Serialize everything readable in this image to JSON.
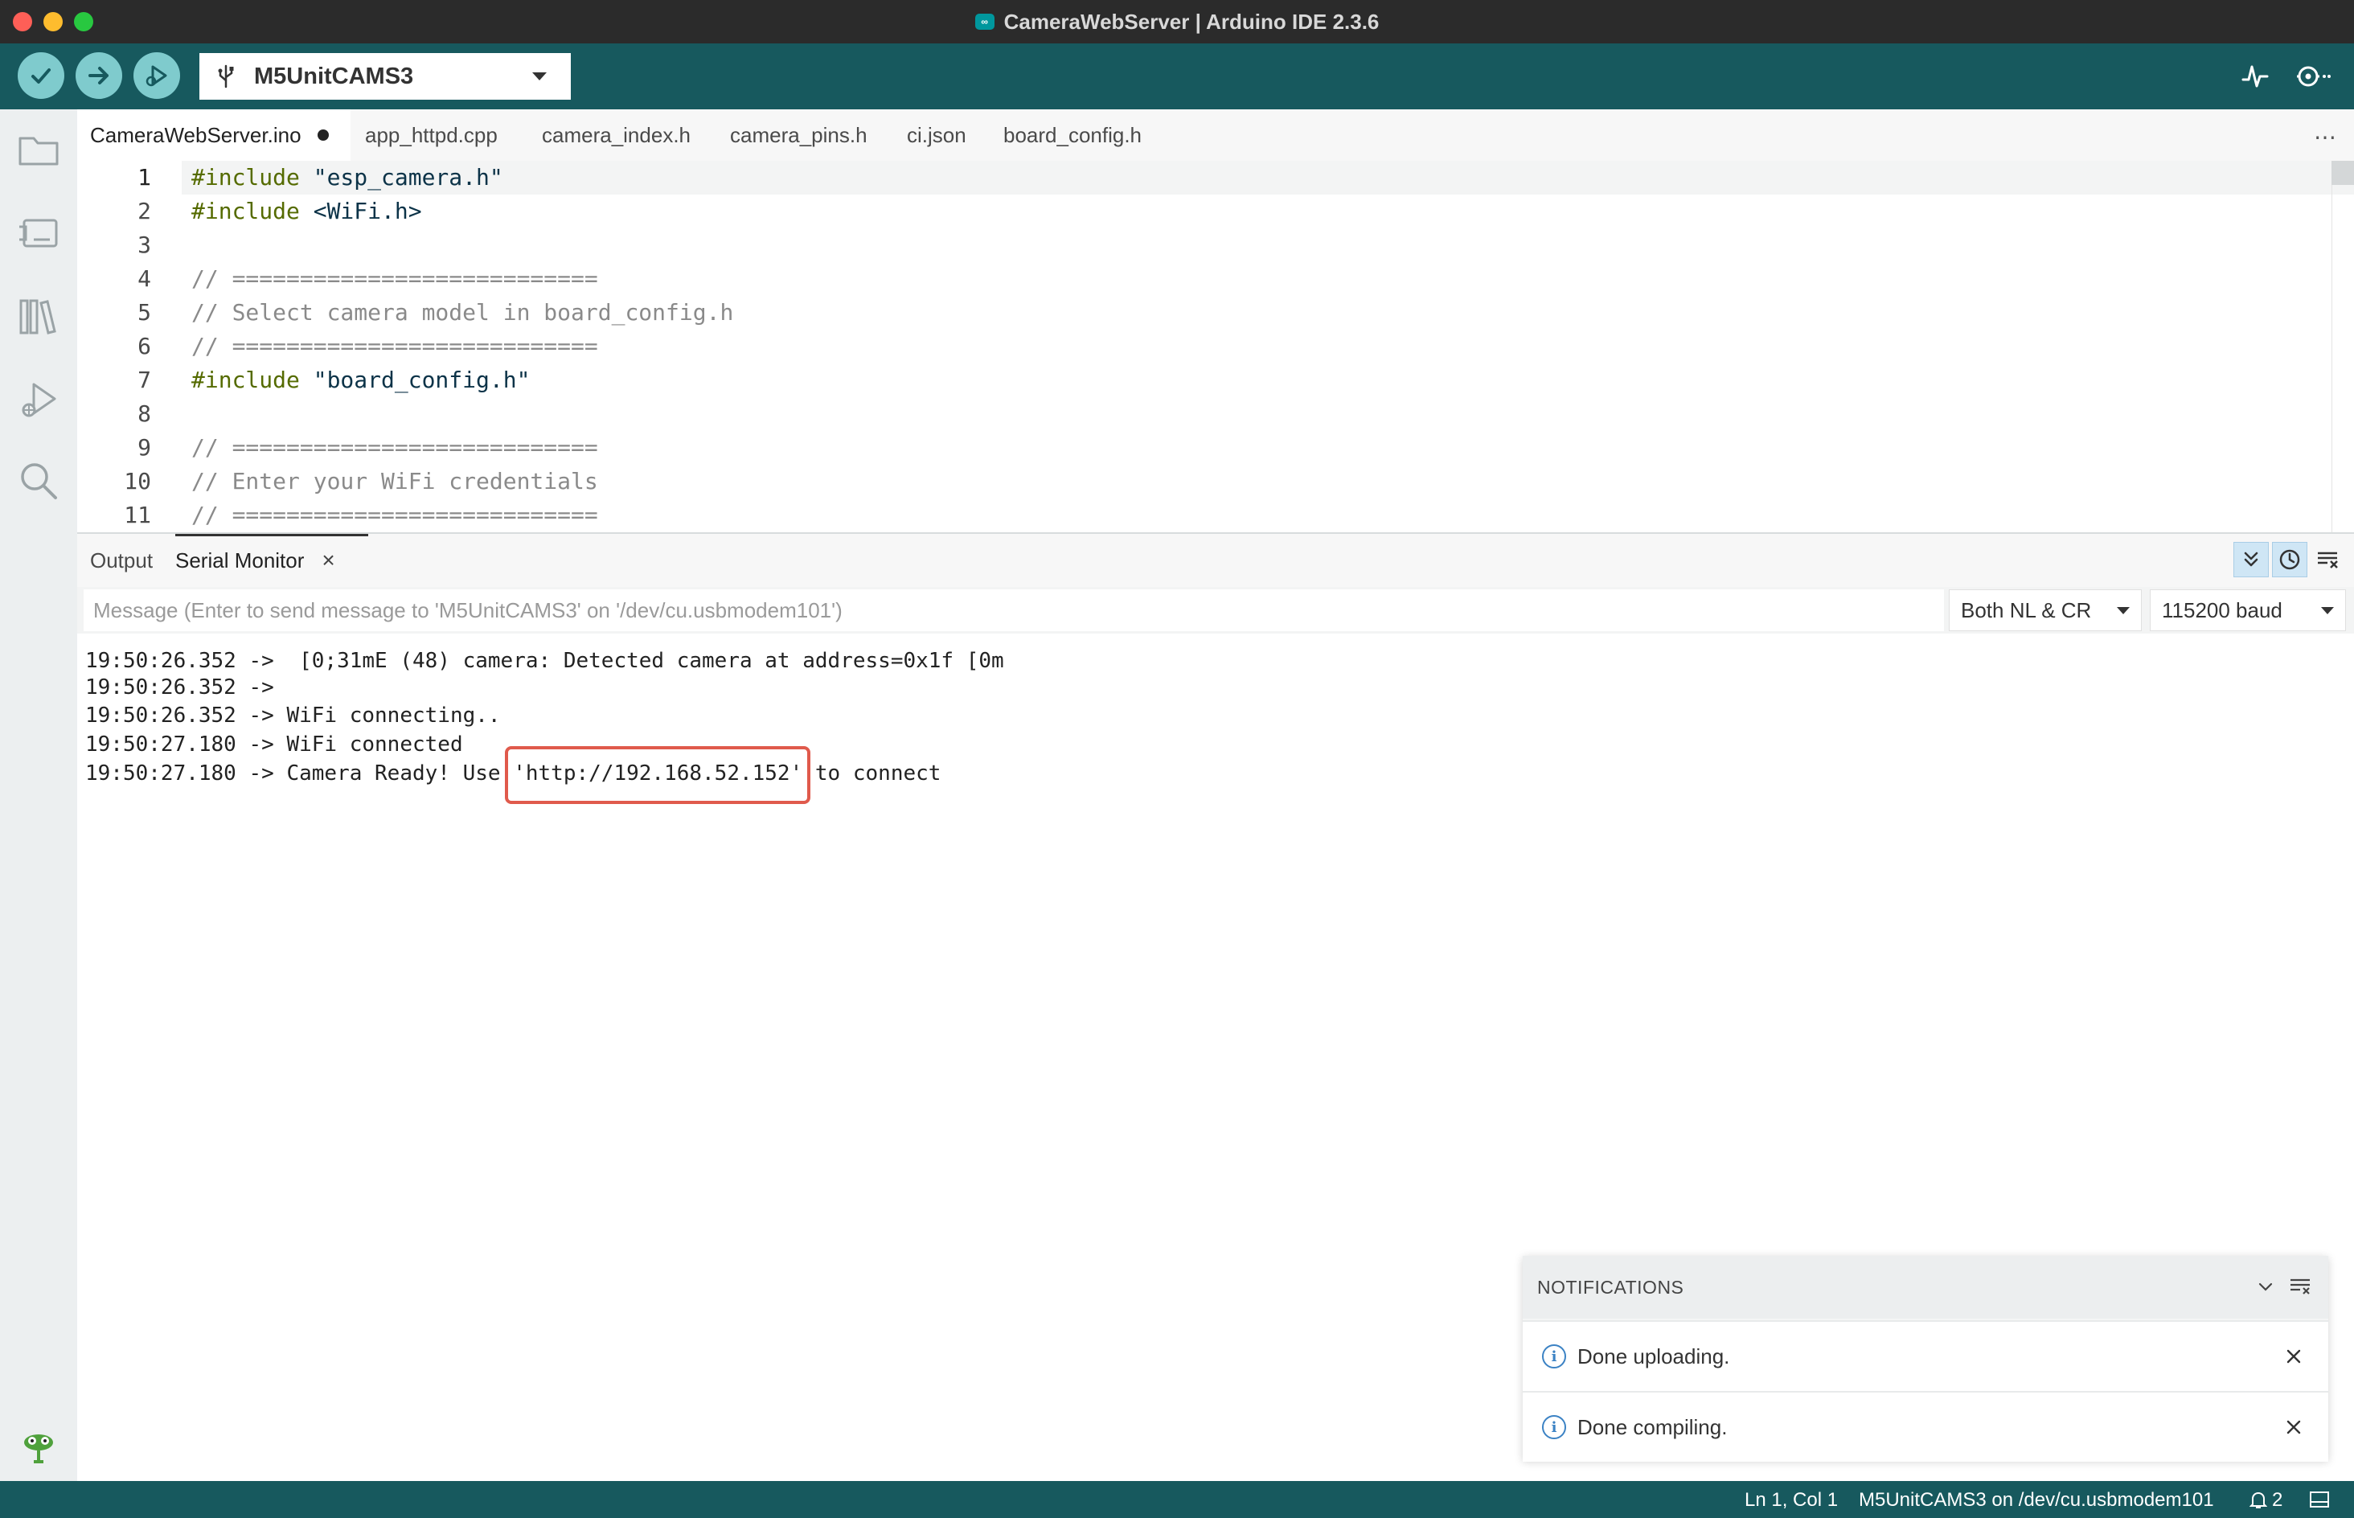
{
  "window": {
    "title": "CameraWebServer | Arduino IDE 2.3.6",
    "app_icon": "arduino-infinity-icon"
  },
  "toolbar": {
    "board": "M5UnitCAMS3",
    "icons": [
      "check-icon",
      "arrow-right-icon",
      "debug-icon",
      "usb-icon",
      "serial-plotter-icon",
      "serial-monitor-icon"
    ]
  },
  "sidebar": {
    "icons": [
      "folder-icon",
      "boards-manager-icon",
      "library-manager-icon",
      "debug-icon",
      "search-icon"
    ]
  },
  "tabs": [
    {
      "label": "CameraWebServer.ino",
      "active": true,
      "modified": true
    },
    {
      "label": "app_httpd.cpp"
    },
    {
      "label": "camera_index.h"
    },
    {
      "label": "camera_pins.h"
    },
    {
      "label": "ci.json"
    },
    {
      "label": "board_config.h"
    }
  ],
  "tabs_more": "⋯",
  "editor": {
    "lines": [
      {
        "num": "1",
        "kw": "#include",
        "rest": " \"esp_camera.h\""
      },
      {
        "num": "2",
        "kw": "#include",
        "rest": " <WiFi.h>"
      },
      {
        "num": "3",
        "text": ""
      },
      {
        "num": "4",
        "comment": "// ==========================="
      },
      {
        "num": "5",
        "comment": "// Select camera model in board_config.h"
      },
      {
        "num": "6",
        "comment": "// ==========================="
      },
      {
        "num": "7",
        "kw": "#include",
        "rest": " \"board_config.h\""
      },
      {
        "num": "8",
        "text": ""
      },
      {
        "num": "9",
        "comment": "// ==========================="
      },
      {
        "num": "10",
        "comment": "// Enter your WiFi credentials"
      },
      {
        "num": "11",
        "comment": "// ==========================="
      }
    ]
  },
  "panel": {
    "tab_output": "Output",
    "tab_serial": "Serial Monitor",
    "tab_close": "×",
    "message_placeholder": "Message (Enter to send message to 'M5UnitCAMS3' on '/dev/cu.usbmodem101')",
    "line_ending": "Both NL & CR",
    "baud_rate": "115200 baud",
    "serial_lines": [
      "19:50:26.352 ->  [0;31mE (48) camera: Detected camera at address=0x1f [0m",
      "19:50:26.352 ->",
      "19:50:26.352 -> WiFi connecting..",
      "19:50:27.180 -> WiFi connected",
      "19:50:27.180 -> Camera Ready! Use 'http://192.168.52.152' to connect"
    ]
  },
  "notifications": {
    "header": "NOTIFICATIONS",
    "items": [
      {
        "text": "Done uploading."
      },
      {
        "text": "Done compiling."
      }
    ]
  },
  "statusbar": {
    "position": "Ln 1, Col 1",
    "board_port": "M5UnitCAMS3 on /dev/cu.usbmodem101",
    "notification_count": "2"
  },
  "colors": {
    "toolbar": "#17595e",
    "button": "#7fcbcd",
    "highlight_box": "#e05a4c"
  }
}
